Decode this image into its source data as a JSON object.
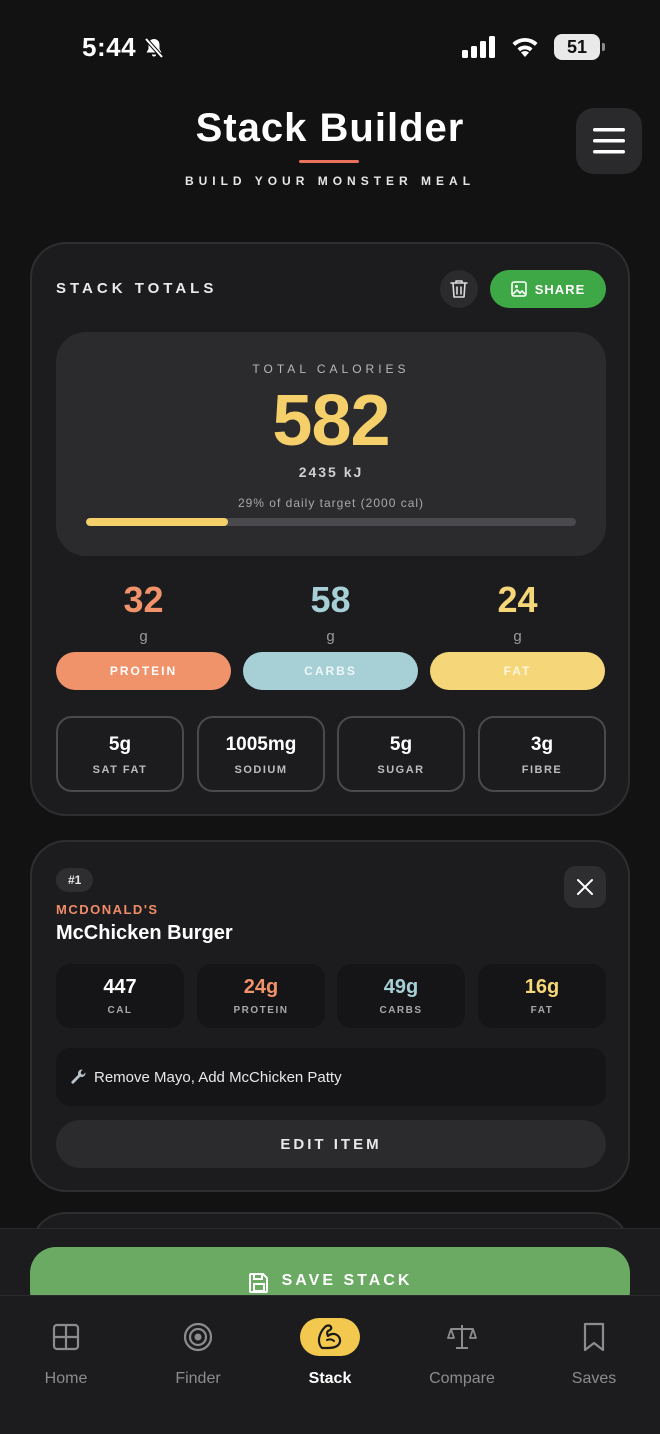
{
  "status": {
    "time": "5:44",
    "battery": "51"
  },
  "header": {
    "title": "Stack Builder",
    "subtitle": "BUILD YOUR MONSTER MEAL"
  },
  "totals": {
    "label": "STACK TOTALS",
    "share_label": "SHARE",
    "calories_label": "TOTAL CALORIES",
    "calories": "582",
    "kj": "2435 kJ",
    "daily_target": "29% of daily target (2000 cal)",
    "daily_progress": 0.29,
    "macros": [
      {
        "value": "32",
        "unit": "g",
        "label": "PROTEIN"
      },
      {
        "value": "58",
        "unit": "g",
        "label": "CARBS"
      },
      {
        "value": "24",
        "unit": "g",
        "label": "FAT"
      }
    ],
    "extras": [
      {
        "value": "5g",
        "label": "SAT FAT"
      },
      {
        "value": "1005mg",
        "label": "SODIUM"
      },
      {
        "value": "5g",
        "label": "SUGAR"
      },
      {
        "value": "3g",
        "label": "FIBRE"
      }
    ]
  },
  "item": {
    "index": "#1",
    "brand": "MCDONALD'S",
    "name": "McChicken Burger",
    "stats": [
      {
        "value": "447",
        "label": "CAL"
      },
      {
        "value": "24g",
        "label": "PROTEIN"
      },
      {
        "value": "49g",
        "label": "CARBS"
      },
      {
        "value": "16g",
        "label": "FAT"
      }
    ],
    "customization": "Remove Mayo, Add McChicken Patty",
    "edit_label": "EDIT ITEM"
  },
  "save_label": "SAVE STACK",
  "tabs": [
    {
      "label": "Home",
      "icon": "grid-icon"
    },
    {
      "label": "Finder",
      "icon": "target-icon"
    },
    {
      "label": "Stack",
      "icon": "flexed-arm-icon"
    },
    {
      "label": "Compare",
      "icon": "scale-icon"
    },
    {
      "label": "Saves",
      "icon": "bookmark-icon"
    }
  ],
  "colors": {
    "protein": "#f0926a",
    "carbs": "#a6d0d6",
    "fat": "#f5d679",
    "calories": "#f5d06a",
    "share": "#3fa846",
    "save": "#6aaa63",
    "active_tab": "#f2c84f"
  }
}
